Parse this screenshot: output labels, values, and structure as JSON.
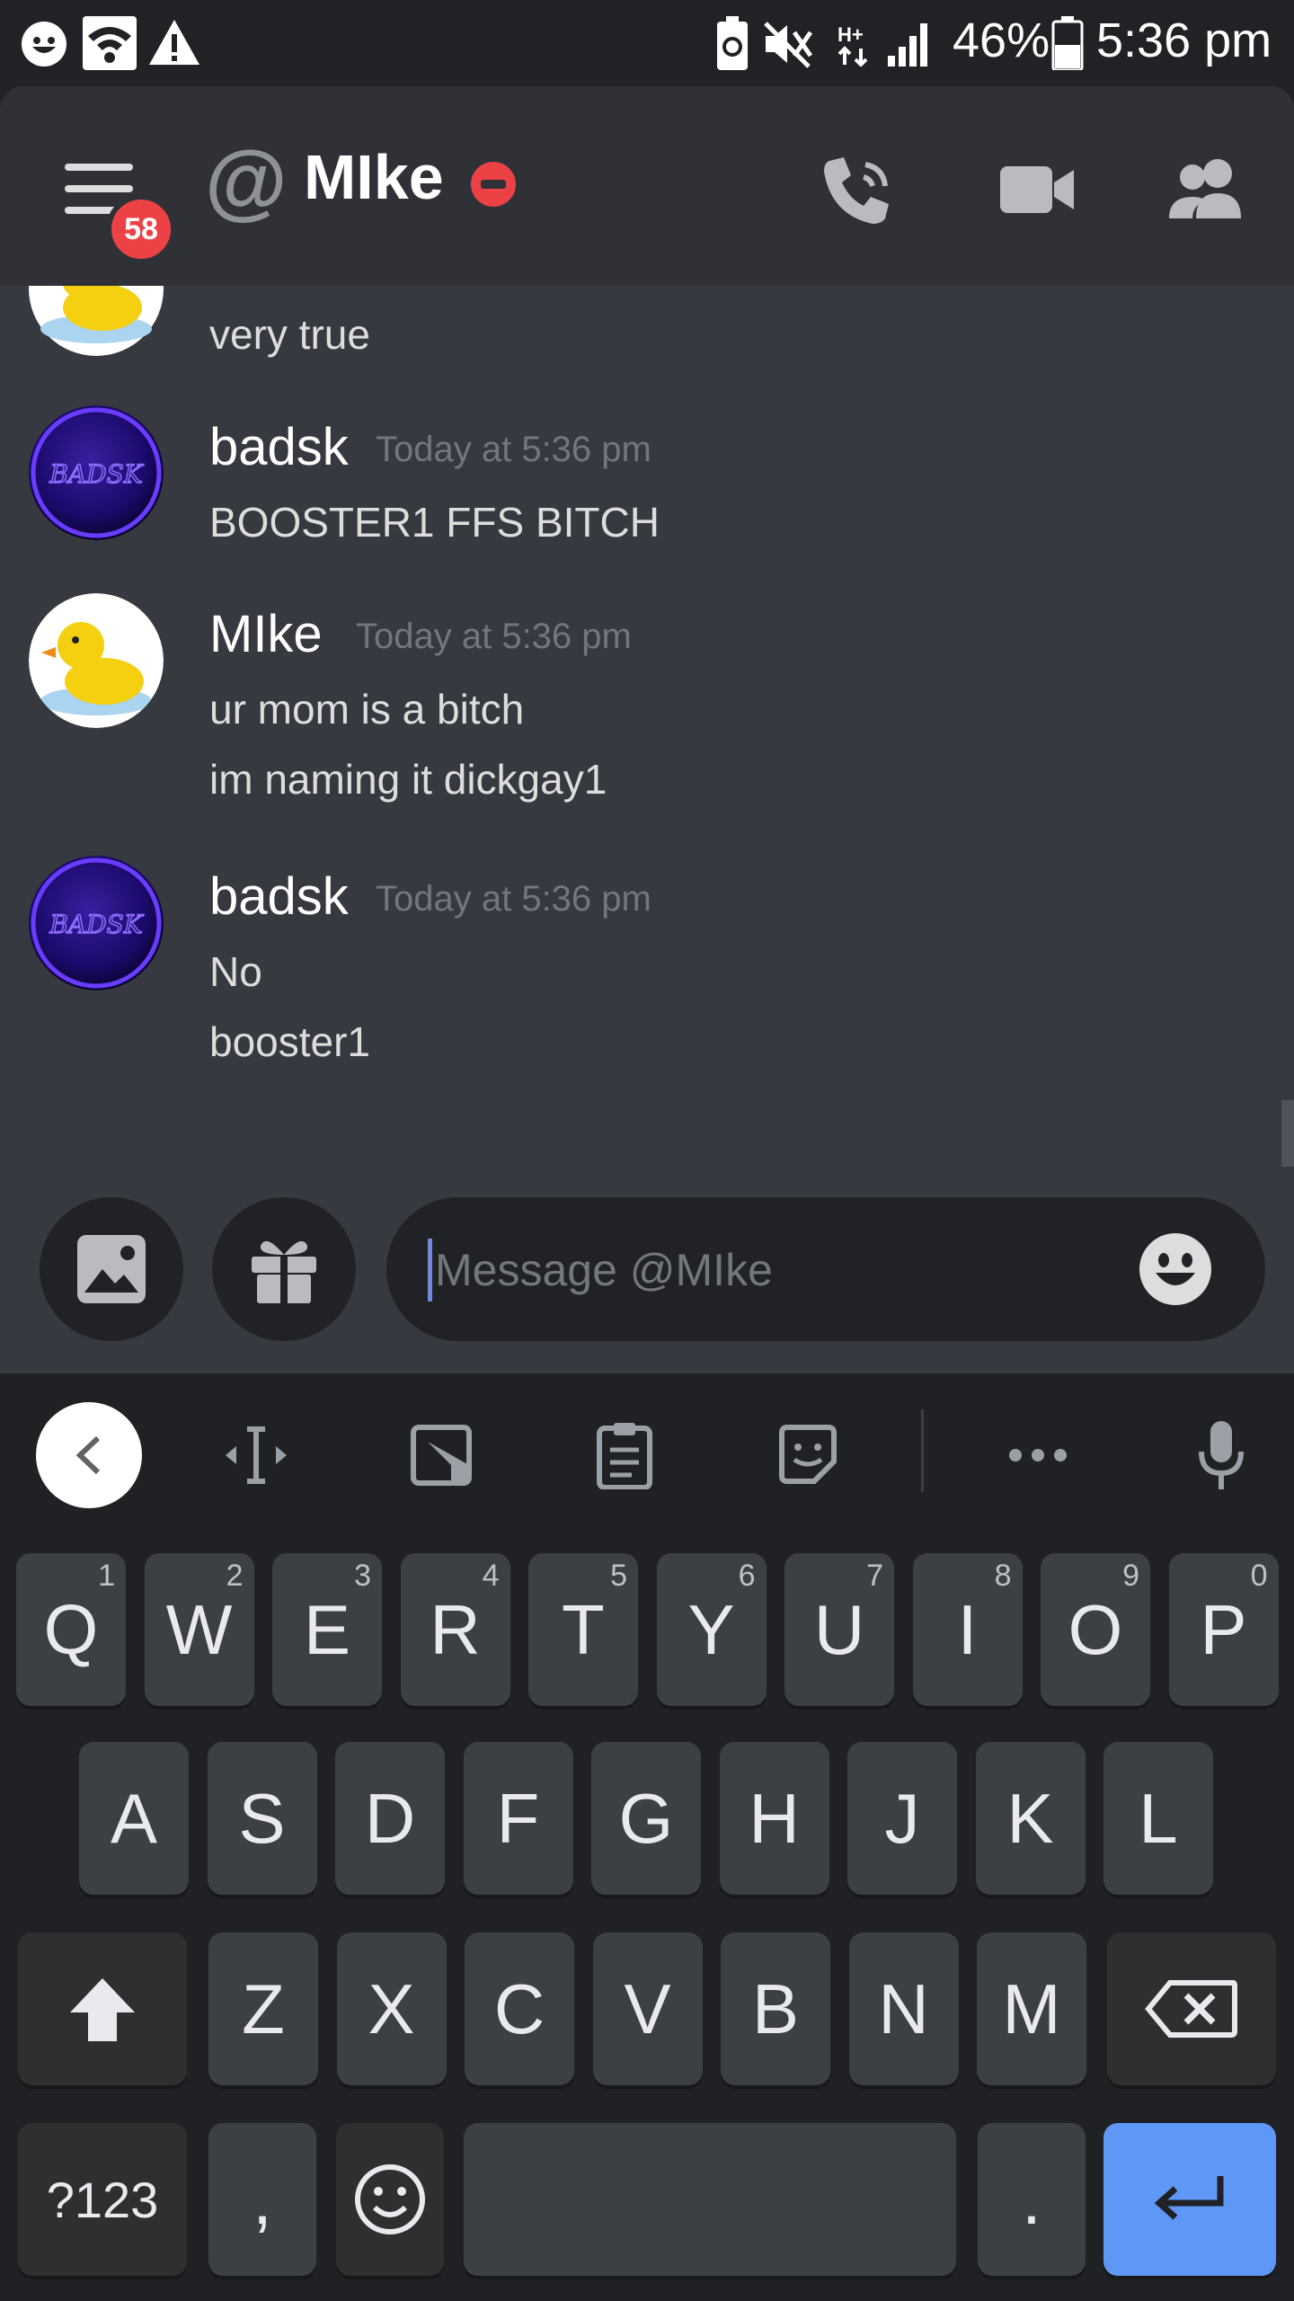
{
  "status_bar": {
    "battery": "46%",
    "time": "5:36 pm",
    "icons": [
      "app-notification-icon",
      "wifi-icon",
      "warning-icon",
      "battery-saver-icon",
      "mute-icon",
      "hplus-data-icon",
      "signal-icon",
      "battery-icon"
    ]
  },
  "header": {
    "unread_badge": "58",
    "at_symbol": "@",
    "channel_name": "MIke",
    "status": "do-not-disturb",
    "buttons": [
      "call-button",
      "video-button",
      "members-button"
    ]
  },
  "messages": [
    {
      "author": "",
      "timestamp": "",
      "lines": [
        "very true"
      ],
      "avatar": "duck"
    },
    {
      "author": "badsk",
      "timestamp": "Today at 5:36 pm",
      "lines": [
        "BOOSTER1 FFS BITCH"
      ],
      "avatar": "badsk"
    },
    {
      "author": "MIke",
      "timestamp": "Today at 5:36 pm",
      "lines": [
        "ur mom is a bitch",
        "im naming it dickgay1"
      ],
      "avatar": "duck"
    },
    {
      "author": "badsk",
      "timestamp": "Today at 5:36 pm",
      "lines": [
        "No",
        "booster1"
      ],
      "avatar": "badsk"
    }
  ],
  "avatar_text": {
    "badsk": "BADSK"
  },
  "composer": {
    "placeholder": "Message @MIke",
    "value": ""
  },
  "keyboard": {
    "row1": [
      {
        "k": "Q",
        "h": "1"
      },
      {
        "k": "W",
        "h": "2"
      },
      {
        "k": "E",
        "h": "3"
      },
      {
        "k": "R",
        "h": "4"
      },
      {
        "k": "T",
        "h": "5"
      },
      {
        "k": "Y",
        "h": "6"
      },
      {
        "k": "U",
        "h": "7"
      },
      {
        "k": "I",
        "h": "8"
      },
      {
        "k": "O",
        "h": "9"
      },
      {
        "k": "P",
        "h": "0"
      }
    ],
    "row2": [
      "A",
      "S",
      "D",
      "F",
      "G",
      "H",
      "J",
      "K",
      "L"
    ],
    "row3": [
      "Z",
      "X",
      "C",
      "V",
      "B",
      "N",
      "M"
    ],
    "symbols_key": "?123",
    "comma_key": ",",
    "period_key": "."
  },
  "colors": {
    "background": "#36393f",
    "header": "#2f3136",
    "danger": "#ed4245",
    "accent": "#7289da",
    "enter_key": "#5e97f6"
  }
}
